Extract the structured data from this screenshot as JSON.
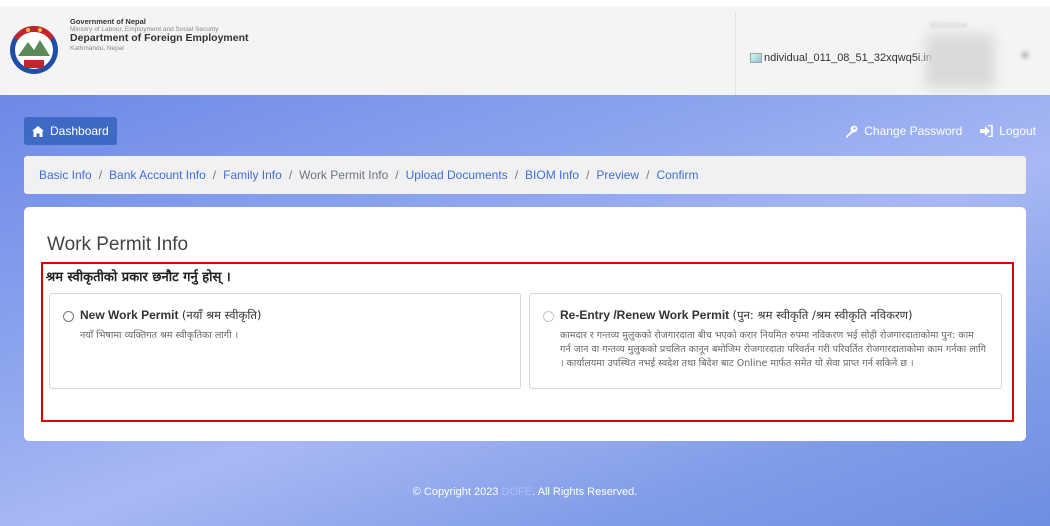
{
  "header": {
    "gov_line": "Government of Nepal",
    "ministry_line": "Ministry of Labour, Employment and Social Security",
    "department_line": "Department of Foreign Employment",
    "location_line": "Kathmandu, Nepal",
    "broken_image_text": "ndividual_011_08_51_32xqwq5i.in",
    "welcome_text": "Welcome"
  },
  "navbar": {
    "dashboard_label": "Dashboard",
    "change_password_label": "Change Password",
    "logout_label": "Logout"
  },
  "breadcrumb": {
    "items": [
      "Basic Info",
      "Bank Account Info",
      "Family Info",
      "Work Permit Info",
      "Upload Documents",
      "BIOM Info",
      "Preview",
      "Confirm"
    ],
    "active_index": 3
  },
  "main": {
    "title": "Work Permit Info",
    "question": "श्रम स्वीकृतीको प्रकार छनौट गर्नु होस् ।",
    "options": [
      {
        "title": "New Work Permit",
        "title_np": "(नयाँ श्रम स्वीकृति)",
        "description": "नयाँ भिषामा व्यक्तिगत श्रम स्वीकृतिका लागी ।",
        "selected": false,
        "enabled": true
      },
      {
        "title": "Re-Entry /Renew Work Permit",
        "title_np": "(पुन: श्रम स्वीकृति /श्रम स्वीकृति नविकरण)",
        "description": "कामदार र गन्तव्य मुलुकको रोजगारदाता बीच भएको करार नियमित रुपमा नविकरण भई सोही रोजगारदाताकोमा पुन: काम गर्न जान वा गन्तव्य मुलुकको प्रचलित कानून बमोजिम रोजगारदाता परिवर्तन गरी परिवर्तित रोजगारदाताकोमा काम गर्नका लागि । कार्यालयमा उपस्थित नभई स्वदेश तथा बिदेश बाट Online मार्फत समेत यो सेवा प्राप्त गर्न सकिने छ ।",
        "selected": false,
        "enabled": false
      }
    ]
  },
  "footer": {
    "prefix": "© Copyright 2023",
    "org": "DOFE",
    "suffix": ". All Rights Reserved."
  },
  "colors": {
    "primary": "#3e69c7",
    "link": "#3e6fd1",
    "highlight_border": "#e00000"
  }
}
